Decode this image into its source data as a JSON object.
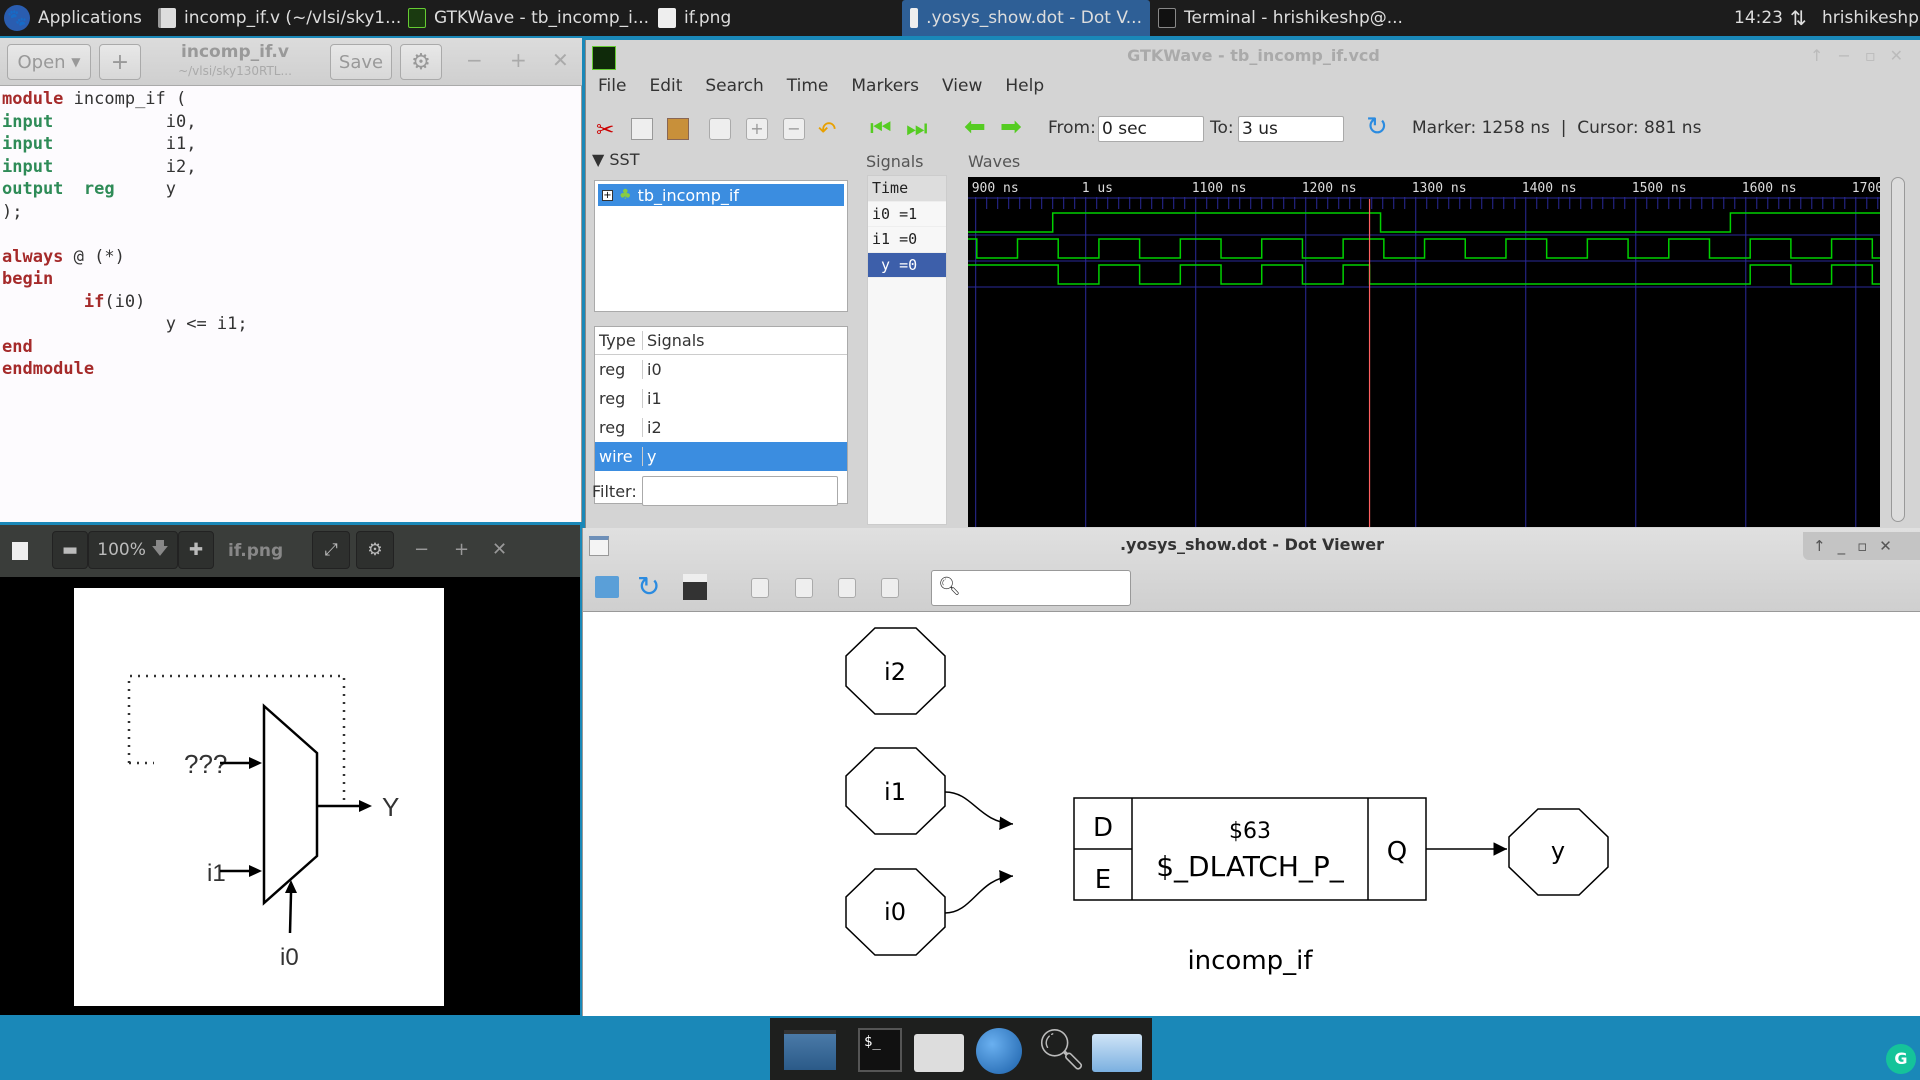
{
  "taskbar": {
    "applications": "Applications",
    "windows": [
      {
        "label": "incomp_if.v (~/vlsi/sky1...",
        "icon": "text-editor-icon"
      },
      {
        "label": "GTKWave - tb_incomp_i...",
        "icon": "gtkwave-icon"
      },
      {
        "label": "if.png",
        "icon": "image-icon"
      },
      {
        "label": ".yosys_show.dot - Dot V...",
        "icon": "window-icon",
        "active": true
      },
      {
        "label": "Terminal - hrishikeshp@...",
        "icon": "terminal-icon"
      }
    ],
    "clock": "14:23",
    "user": "hrishikeshp"
  },
  "editor": {
    "open_label": "Open",
    "new_label": "+",
    "title": "incomp_if.v",
    "subtitle": "~/vlsi/sky130RTL...",
    "save_label": "Save",
    "code_lines": [
      [
        {
          "t": "module",
          "c": "kw"
        },
        {
          "t": " incomp_if (",
          "c": ""
        }
      ],
      [
        {
          "t": "input",
          "c": "ty"
        },
        {
          "t": "           i0,",
          "c": ""
        }
      ],
      [
        {
          "t": "input",
          "c": "ty"
        },
        {
          "t": "           i1,",
          "c": ""
        }
      ],
      [
        {
          "t": "input",
          "c": "ty"
        },
        {
          "t": "           i2,",
          "c": ""
        }
      ],
      [
        {
          "t": "output",
          "c": "ty"
        },
        {
          "t": "  ",
          "c": ""
        },
        {
          "t": "reg",
          "c": "ty"
        },
        {
          "t": "     y",
          "c": ""
        }
      ],
      [
        {
          "t": ");",
          "c": ""
        }
      ],
      [
        {
          "t": "",
          "c": ""
        }
      ],
      [
        {
          "t": "always",
          "c": "kw"
        },
        {
          "t": " @ (*)",
          "c": ""
        }
      ],
      [
        {
          "t": "begin",
          "c": "kw"
        }
      ],
      [
        {
          "t": "        ",
          "c": ""
        },
        {
          "t": "if",
          "c": "kw"
        },
        {
          "t": "(i0)",
          "c": ""
        }
      ],
      [
        {
          "t": "                y <= i1;",
          "c": ""
        }
      ],
      [
        {
          "t": "end",
          "c": "kw"
        }
      ],
      [
        {
          "t": "endmodule",
          "c": "kw"
        }
      ]
    ]
  },
  "gtkwave": {
    "title": "GTKWave - tb_incomp_if.vcd",
    "menu": [
      "File",
      "Edit",
      "Search",
      "Time",
      "Markers",
      "View",
      "Help"
    ],
    "from_label": "From:",
    "from_value": "0 sec",
    "to_label": "To:",
    "to_value": "3 us",
    "marker_text": "Marker: 1258 ns  |  Cursor: 881 ns",
    "sst_label": "SST",
    "tree_item": "tb_incomp_if",
    "type_header": "Type",
    "signals_header": "Signals",
    "signal_rows": [
      {
        "type": "reg",
        "name": "i0"
      },
      {
        "type": "reg",
        "name": "i1"
      },
      {
        "type": "reg",
        "name": "i2"
      },
      {
        "type": "wire",
        "name": "y",
        "selected": true
      }
    ],
    "filter_label": "Filter:",
    "signals_panel_label": "Signals",
    "waves_panel_label": "Waves",
    "signal_values": [
      {
        "label": "Time"
      },
      {
        "label": "i0 =1"
      },
      {
        "label": "i1 =0"
      },
      {
        "label": " y =0",
        "selected": true
      }
    ],
    "time_labels": [
      "900 ns",
      "1 us",
      "1100 ns",
      "1200 ns",
      "1300 ns",
      "1400 ns",
      "1500 ns",
      "1600 ns",
      "1700"
    ],
    "time_ticks_ns": [
      900,
      1000,
      1100,
      1200,
      1300,
      1400,
      1500,
      1600,
      1700
    ],
    "view_range_ns": [
      893,
      1722
    ],
    "marker_ns": 1258,
    "waveforms": [
      {
        "name": "i0",
        "start": 0,
        "edges_ns": [
          970,
          1268,
          1586
        ]
      },
      {
        "name": "i1",
        "start": 1,
        "edges_ns": [
          893,
          901,
          938,
          975,
          1012,
          1049,
          1086,
          1123,
          1160,
          1197,
          1234,
          1271,
          1308,
          1345,
          1382,
          1419,
          1456,
          1493,
          1530,
          1567,
          1604,
          1641,
          1678,
          1715
        ]
      },
      {
        "name": "y",
        "start": 1,
        "edges_ns": [
          975,
          1012,
          1049,
          1086,
          1123,
          1160,
          1197,
          1234,
          1258,
          1604,
          1641,
          1678,
          1715
        ]
      }
    ],
    "wave_color": "#00d000"
  },
  "image_viewer": {
    "zoom": "100%",
    "title": "if.png",
    "diagram": {
      "unknown_label": "???",
      "i1_label": "i1",
      "i0_label": "i0",
      "y_label": "Y"
    }
  },
  "dot_viewer": {
    "title": ".yosys_show.dot - Dot Viewer",
    "search_placeholder": "",
    "nodes": {
      "i2": "i2",
      "i1": "i1",
      "i0": "i0",
      "y": "y"
    },
    "cell": {
      "id": "$63",
      "type": "$_DLATCH_P_",
      "d": "D",
      "e": "E",
      "q": "Q"
    },
    "module_label": "incomp_if"
  }
}
